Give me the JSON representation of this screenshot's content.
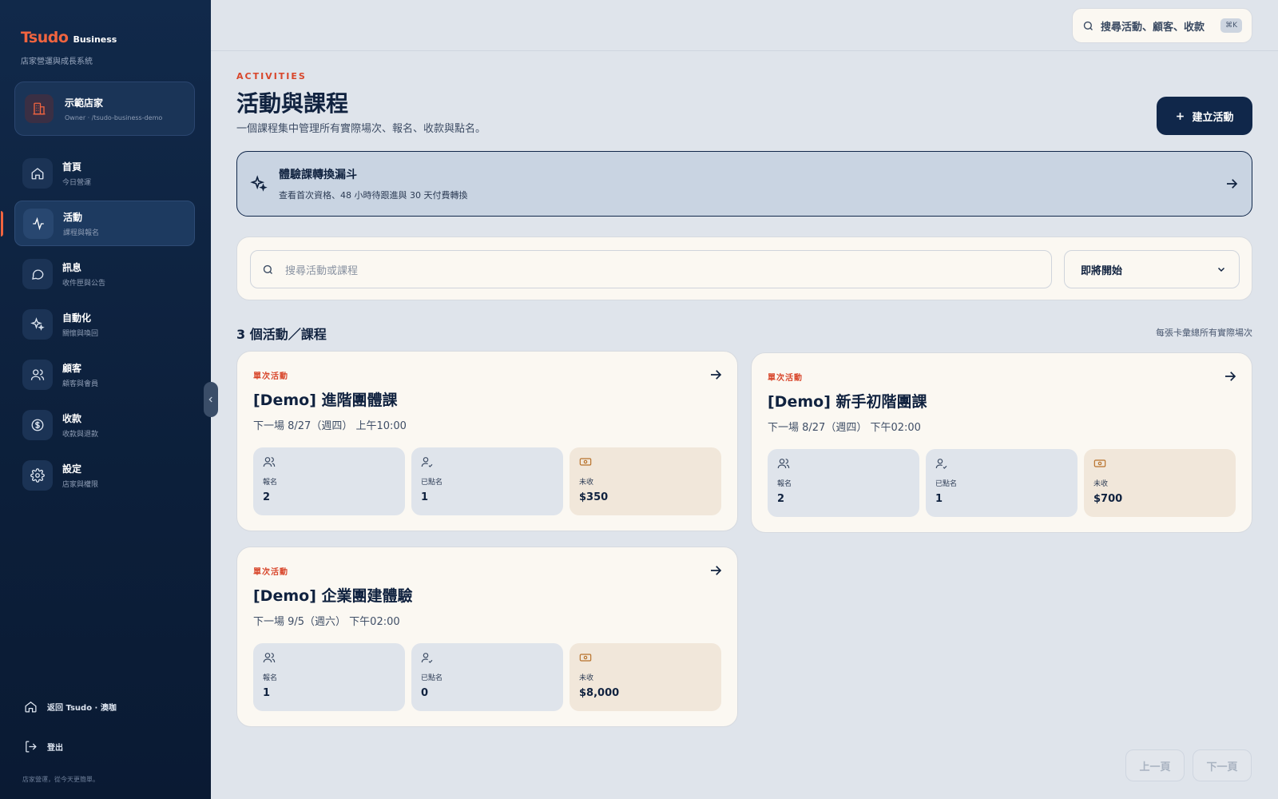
{
  "brand": {
    "logo": "Tsudo",
    "sub": "Business",
    "tagline": "店家營運與成長系統"
  },
  "store": {
    "name": "示範店家",
    "meta": "Owner · /tsudo-business-demo"
  },
  "nav": [
    {
      "label": "首頁",
      "sub": "今日營運",
      "icon": "home-icon"
    },
    {
      "label": "活動",
      "sub": "課程與報名",
      "icon": "activity-icon"
    },
    {
      "label": "訊息",
      "sub": "收件匣與公告",
      "icon": "message-icon"
    },
    {
      "label": "自動化",
      "sub": "關懷與喚回",
      "icon": "sparkle-icon"
    },
    {
      "label": "顧客",
      "sub": "顧客與會員",
      "icon": "users-icon"
    },
    {
      "label": "收款",
      "sub": "收款與退款",
      "icon": "dollar-icon"
    },
    {
      "label": "設定",
      "sub": "店家與權限",
      "icon": "gear-icon"
    }
  ],
  "footer": {
    "back": "返回 Tsudo · 澳咖",
    "logout": "登出",
    "note": "店家營運，從今天更簡單。"
  },
  "search": {
    "label": "搜尋活動、顧客、收款",
    "shortcut": "⌘K"
  },
  "header": {
    "eyebrow": "ACTIVITIES",
    "title": "活動與課程",
    "description": "一個課程集中管理所有實際場次、報名、收款與點名。",
    "create_label": "建立活動"
  },
  "funnel": {
    "title": "體驗課轉換漏斗",
    "description": "查看首次資格、48 小時待跟進與 30 天付費轉換"
  },
  "filter": {
    "placeholder": "搜尋活動或課程",
    "sort": "即將開始"
  },
  "list": {
    "count_title": "3 個活動／課程",
    "note": "每張卡彙總所有實際場次"
  },
  "activities": [
    {
      "type": "單次活動",
      "title": "[Demo] 進階團體課",
      "next": "下一場 8/27（週四） 上午10:00",
      "stats": [
        {
          "label": "報名",
          "value": "2"
        },
        {
          "label": "已點名",
          "value": "1"
        },
        {
          "label": "未收",
          "value": "$350"
        }
      ]
    },
    {
      "type": "單次活動",
      "title": "[Demo] 新手初階團課",
      "next": "下一場 8/27（週四） 下午02:00",
      "stats": [
        {
          "label": "報名",
          "value": "2"
        },
        {
          "label": "已點名",
          "value": "1"
        },
        {
          "label": "未收",
          "value": "$700"
        }
      ]
    },
    {
      "type": "單次活動",
      "title": "[Demo] 企業團建體驗",
      "next": "下一場 9/5（週六） 下午02:00",
      "stats": [
        {
          "label": "報名",
          "value": "1"
        },
        {
          "label": "已點名",
          "value": "0"
        },
        {
          "label": "未收",
          "value": "$8,000"
        }
      ]
    }
  ],
  "pager": {
    "prev": "上一頁",
    "next": "下一頁"
  },
  "colors": {
    "accent": "#f0643f",
    "navy": "#10274a",
    "alert": "#d8462b",
    "warm": "#f1e7da"
  }
}
